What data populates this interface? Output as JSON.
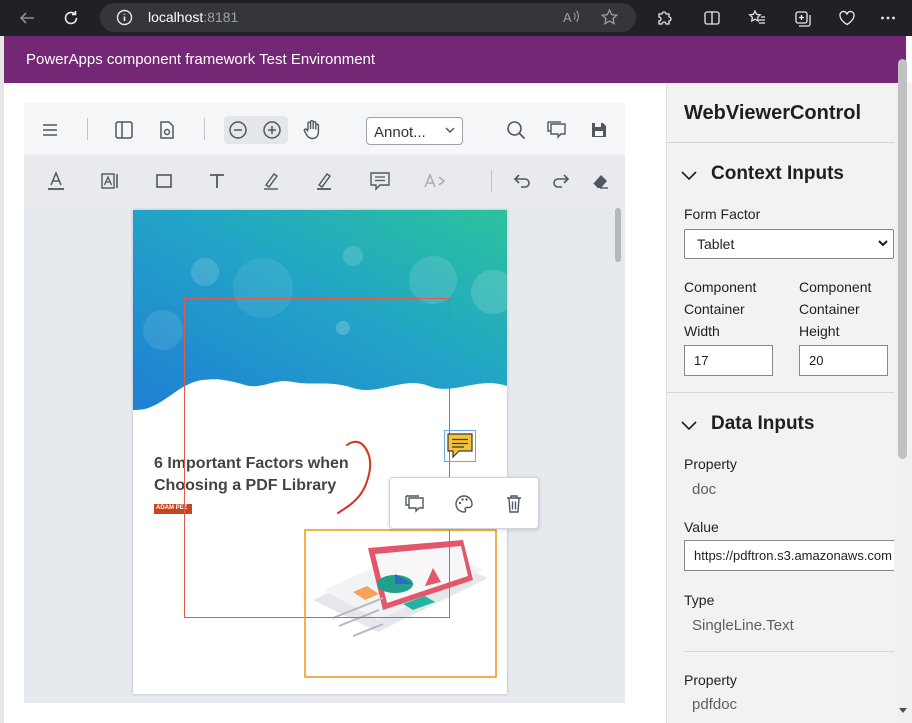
{
  "browser": {
    "url_host": "localhost",
    "url_port": ":8181",
    "icons": [
      "back-arrow-icon",
      "refresh-icon",
      "info-icon",
      "read-aloud-icon",
      "favorite-star-icon",
      "extensions-icon",
      "split-screen-icon",
      "favorites-icon",
      "collections-icon",
      "browser-essentials-icon",
      "more-icon"
    ]
  },
  "app": {
    "header_title": "PowerApps component framework Test Environment",
    "header_color": "#742774"
  },
  "viewer": {
    "annotation_select": "Annot...",
    "toolbar1_icons": [
      "menu-icon",
      "left-panel-icon",
      "page-settings-icon",
      "zoom-out-icon",
      "zoom-in-icon",
      "pan-hand-icon",
      "search-icon",
      "comments-icon",
      "save-icon"
    ],
    "toolbar2_icons": [
      "text-underline-icon",
      "free-text-icon",
      "rectangle-icon",
      "text-tool-icon",
      "highlight-pen-icon",
      "freehand-pen-icon",
      "sticky-note-icon",
      "text-replace-icon",
      "undo-icon",
      "redo-icon",
      "eraser-icon"
    ],
    "page": {
      "title_line1": "6 Important Factors when",
      "title_line2": "Choosing a PDF Library",
      "author": "ADAM PEZ"
    },
    "popup_icons": [
      "comment-icon",
      "color-palette-icon",
      "delete-icon"
    ],
    "colors": {
      "rect_annotation": "#e15a4a",
      "image_selection": "#f29c1f",
      "ink": "#d4331f",
      "note": "#f5c335"
    }
  },
  "panel": {
    "title": "WebViewerControl",
    "context_section": "Context Inputs",
    "form_factor_label": "Form Factor",
    "form_factor_value": "Tablet",
    "width_label": [
      "Component",
      "Container",
      "Width"
    ],
    "height_label": [
      "Component",
      "Container",
      "Height"
    ],
    "width_value": "17",
    "height_value": "20",
    "data_section": "Data Inputs",
    "property_label": "Property",
    "property1_value": "doc",
    "value_label": "Value",
    "value1": "https://pdftron.s3.amazonaws.com",
    "type_label": "Type",
    "type1_value": "SingleLine.Text",
    "property2_value": "pdfdoc"
  }
}
